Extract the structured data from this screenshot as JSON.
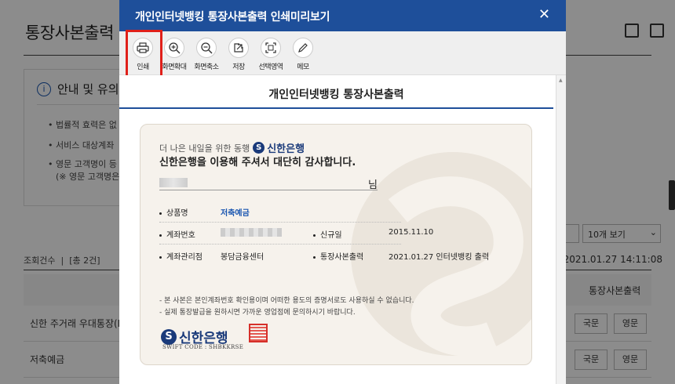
{
  "background": {
    "page_title": "통장사본출력",
    "notice_heading": "안내 및 유의",
    "bullets": [
      "법률적 효력은 없",
      "서비스 대상계좌",
      "영문 고객명이 등",
      "(※ 영문 고객명은"
    ],
    "page_size_select": "10개 보기",
    "count_label": "조회건수",
    "count_value": "[총 2건]",
    "query_time": "2021.01.27 14:11:08",
    "column_header": "통장사본출력",
    "rows": [
      {
        "name": "신한 주거래 우대통장(FI",
        "btn_korean": "국문",
        "btn_english": "영문"
      },
      {
        "name": "저축예금",
        "btn_korean": "국문",
        "btn_english": "영문"
      }
    ]
  },
  "modal": {
    "title": "개인인터넷뱅킹 통장사본출력 인쇄미리보기",
    "close_icon": "close-icon",
    "toolbar": [
      {
        "label": "인쇄",
        "icon": "print-icon"
      },
      {
        "label": "화면확대",
        "icon": "zoom-in-icon"
      },
      {
        "label": "화면축소",
        "icon": "zoom-out-icon"
      },
      {
        "label": "저장",
        "icon": "save-icon"
      },
      {
        "label": "선택영역",
        "icon": "select-area-icon"
      },
      {
        "label": "메모",
        "icon": "memo-icon"
      }
    ],
    "highlight_color": "#e0201a",
    "header_color": "#1e4f9a"
  },
  "document": {
    "title": "개인인터넷뱅킹 통장사본출력",
    "greeting": "더 나은 내일을 위한 동행",
    "bank_name": "신한은행",
    "thanks": "신한은행을 이용해 주셔서 대단히 감사합니다.",
    "name_suffix": "님",
    "product_label": "상품명",
    "product_value": "저축예금",
    "account_label": "계좌번호",
    "new_label": "신규일",
    "new_value": "2015.11.10",
    "branch_label": "계좌관리점",
    "branch_value": "봉담금융센터",
    "print_label": "통장사본출력",
    "print_value": "2021.01.27 인터넷뱅킹 출력",
    "notes": [
      "본 사본은 본인계좌번호 확인용이며 어떠한 용도의 증명서로도 사용하실 수 없습니다.",
      "실제 통장발급을 원하시면 가까운 영업점에 문의하시기 바랍니다."
    ],
    "swift": "SWIFT CODE : SHBKKRSE"
  }
}
